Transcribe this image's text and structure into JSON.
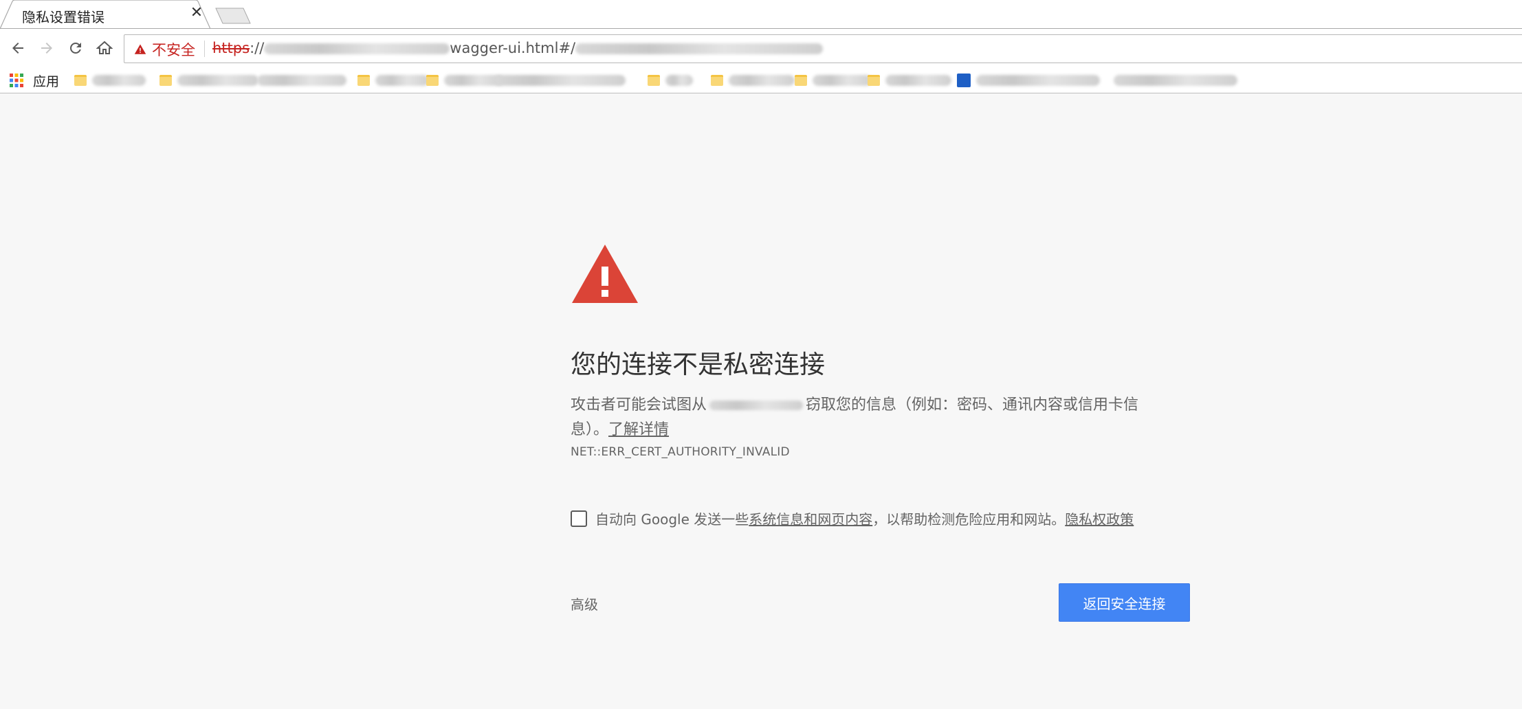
{
  "tab": {
    "title": "隐私设置错误",
    "close_glyph": "✕"
  },
  "toolbar": {
    "security_label": "不安全",
    "url_scheme": "https",
    "url_visible": "://",
    "url_path_fragment": "wagger-ui.html#/"
  },
  "bookmarks": {
    "apps_label": "应用"
  },
  "interstitial": {
    "heading": "您的连接不是私密连接",
    "explain_prefix": "攻击者可能会试图从",
    "explain_suffix": "窃取您的信息（例如：密码、通讯内容或信用卡信息）。",
    "learn_more": "了解详情",
    "error_code": "NET::ERR_CERT_AUTHORITY_INVALID",
    "report_prefix": "自动向 Google 发送一些",
    "report_link": "系统信息和网页内容",
    "report_middle": "，以帮助检测危险应用和网站。",
    "privacy_link": "隐私权政策",
    "report_checked": false,
    "advanced_label": "高级",
    "back_button_label": "返回安全连接"
  },
  "colors": {
    "page_background": "#f7f7f7",
    "warning_red": "#db4437",
    "primary_button": "#4285f4",
    "insecure_text": "#c5221f"
  }
}
